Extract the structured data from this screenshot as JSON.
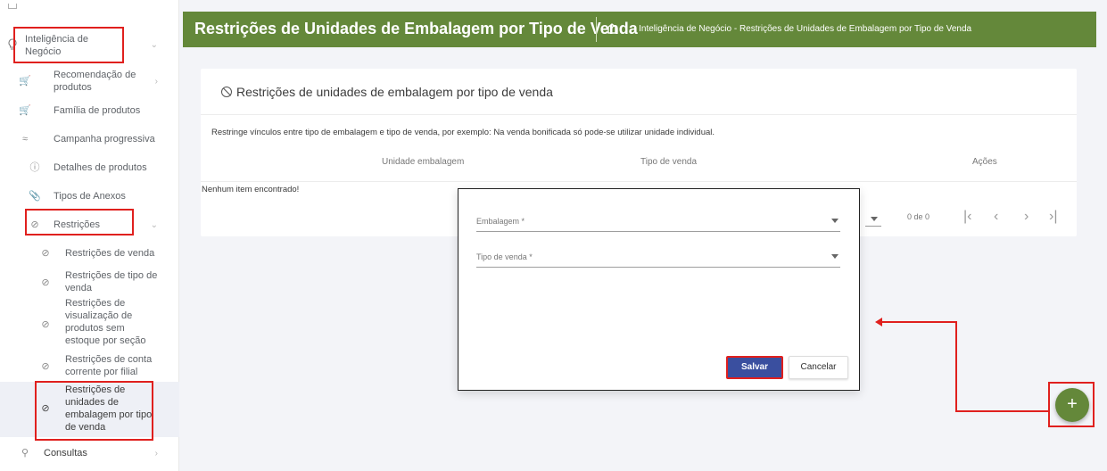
{
  "header": {
    "title": "Restrições de Unidades de Embalagem por Tipo de Venda",
    "breadcrumb": "- Inteligência de Negócio - Restrições de Unidades de Embalagem por Tipo de Venda",
    "color": "#64883a"
  },
  "sidebar": {
    "inteligencia": "Inteligência de Negócio",
    "items": [
      {
        "label": "Recomendação de produtos",
        "icon": "cart-icon"
      },
      {
        "label": "Família de produtos",
        "icon": "cart-icon"
      },
      {
        "label": "Campanha progressiva",
        "icon": "trend-icon"
      },
      {
        "label": "Detalhes de produtos",
        "icon": "info-icon"
      },
      {
        "label": "Tipos de Anexos",
        "icon": "paperclip-icon"
      }
    ],
    "restricoes": "Restrições",
    "sub": [
      "Restrições de venda",
      "Restrições de tipo de venda",
      "Restrições de visualização de produtos sem estoque por seção",
      "Restrições de conta corrente por filial",
      "Restrições de unidades de embalagem por tipo de venda"
    ],
    "consultas": "Consultas"
  },
  "card": {
    "title": "Restrições de unidades de embalagem por tipo de venda",
    "description": "Restringe vínculos entre tipo de embalagem e tipo de venda, por exemplo: Na venda bonificada só pode-se utilizar unidade individual.",
    "columns": [
      "Unidade embalagem",
      "Tipo de venda",
      "Ações"
    ],
    "empty": "Nenhum item encontrado!",
    "pager": "0 de 0"
  },
  "dialog": {
    "field1": "Embalagem *",
    "field2": "Tipo de venda *",
    "save": "Salvar",
    "cancel": "Cancelar",
    "save_color": "#3a4f9f"
  },
  "fab": {
    "label": "+"
  },
  "annotation_color": "#e0201e"
}
